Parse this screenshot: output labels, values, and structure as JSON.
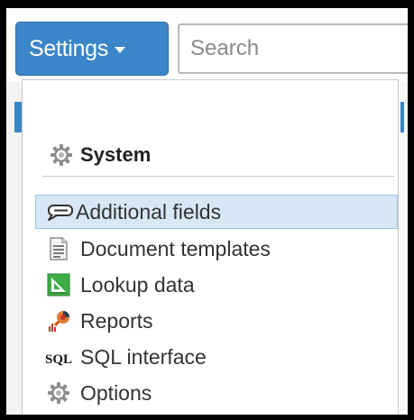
{
  "toolbar": {
    "settings_label": "Settings",
    "search_placeholder": "Search"
  },
  "menu": {
    "section_title": "System",
    "section_icon": "gear-icon",
    "items": [
      {
        "label": "Additional fields",
        "icon": "speech-bubble-icon",
        "highlighted": true
      },
      {
        "label": "Document templates",
        "icon": "document-icon",
        "highlighted": false
      },
      {
        "label": "Lookup data",
        "icon": "lookup-chart-icon",
        "highlighted": false
      },
      {
        "label": "Reports",
        "icon": "reports-icon",
        "highlighted": false
      },
      {
        "label": "SQL interface",
        "icon": "sql-icon",
        "highlighted": false
      },
      {
        "label": "Options",
        "icon": "gear-icon",
        "highlighted": false
      }
    ]
  },
  "colors": {
    "accent": "#3a86c8",
    "highlight": "#d7e7f6"
  }
}
